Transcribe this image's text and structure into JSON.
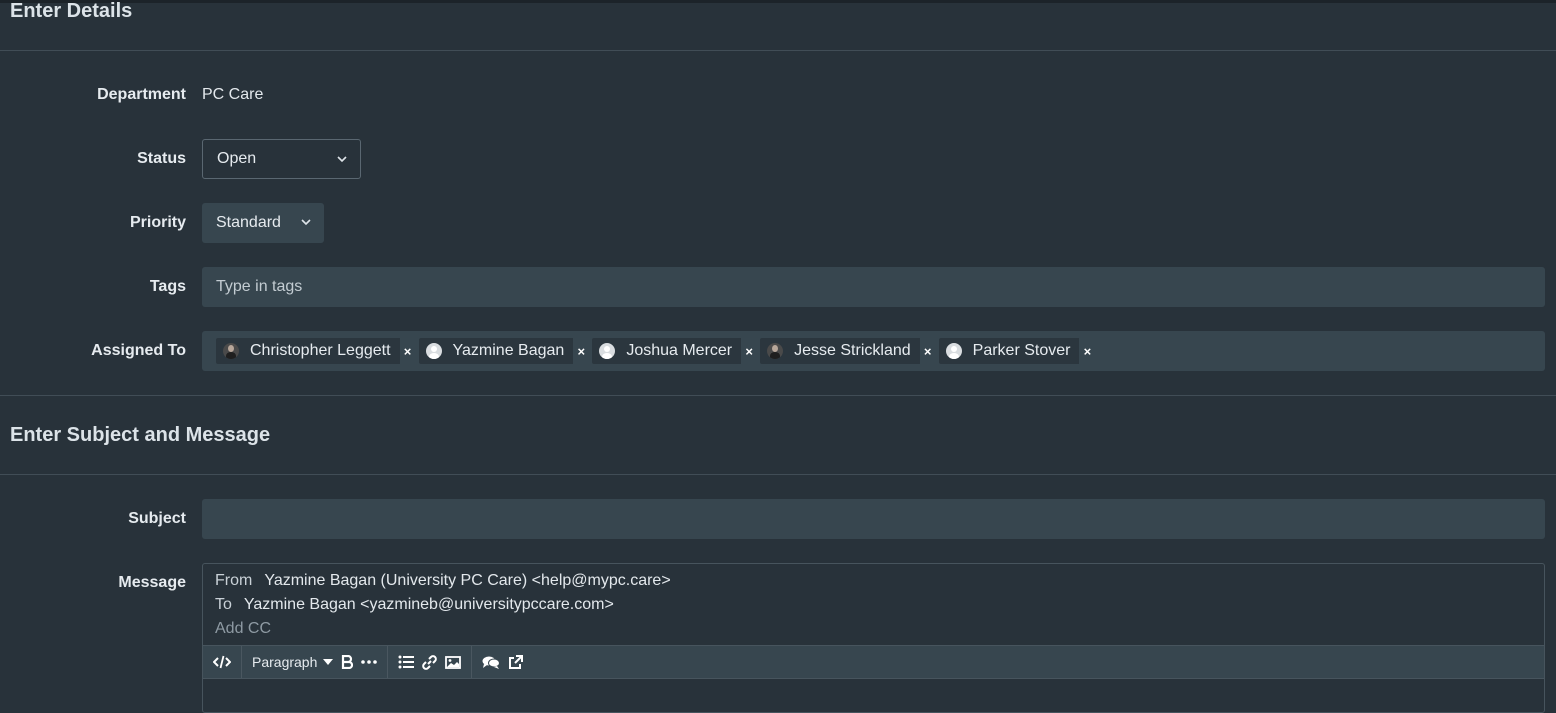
{
  "details": {
    "section_title": "Enter Details",
    "department": {
      "label": "Department",
      "value": "PC Care"
    },
    "status": {
      "label": "Status",
      "value": "Open"
    },
    "priority": {
      "label": "Priority",
      "value": "Standard"
    },
    "tags": {
      "label": "Tags",
      "placeholder": "Type in tags"
    },
    "assigned_to": {
      "label": "Assigned To",
      "assignees": [
        {
          "name": "Christopher Leggett",
          "avatar": "photo"
        },
        {
          "name": "Yazmine Bagan",
          "avatar": "default"
        },
        {
          "name": "Joshua Mercer",
          "avatar": "default"
        },
        {
          "name": "Jesse Strickland",
          "avatar": "photo"
        },
        {
          "name": "Parker Stover",
          "avatar": "default"
        }
      ],
      "remove_glyph": "×"
    }
  },
  "subject_message": {
    "section_title": "Enter Subject and Message",
    "subject": {
      "label": "Subject",
      "value": ""
    },
    "message": {
      "label": "Message",
      "from_label": "From",
      "from_value": "Yazmine Bagan (University PC Care) <help@mypc.care>",
      "to_label": "To",
      "to_value": "Yazmine Bagan <yazmineb@universitypccare.com>",
      "add_cc": "Add CC",
      "toolbar": {
        "block_format": "Paragraph",
        "icons": [
          "code-icon",
          "bold-icon",
          "more-icon",
          "bullet-list-icon",
          "link-icon",
          "image-icon",
          "comments-icon",
          "external-link-icon"
        ]
      }
    }
  }
}
